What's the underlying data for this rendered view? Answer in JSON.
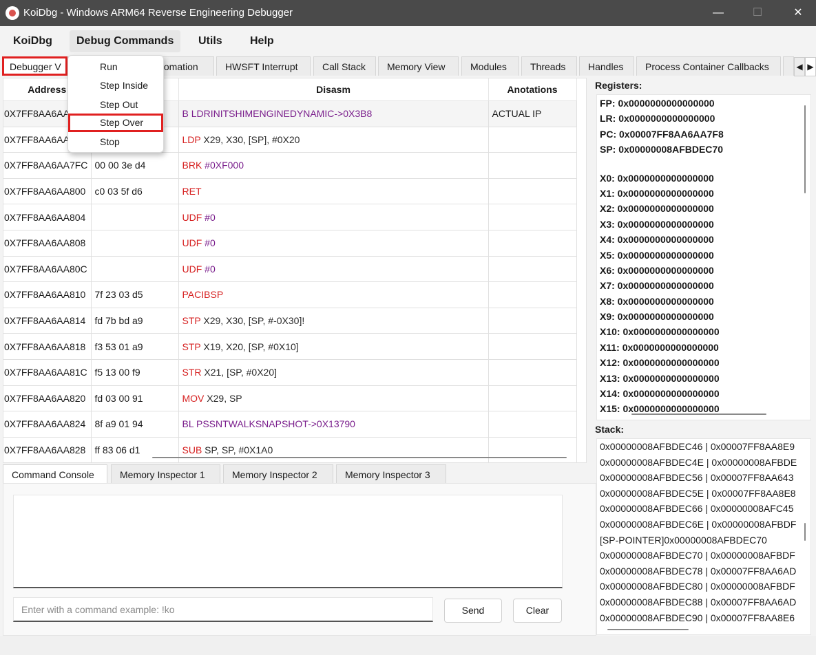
{
  "window": {
    "title": "KoiDbg - Windows ARM64 Reverse Engineering Debugger",
    "minimize": "—",
    "maximize": "☐",
    "close": "✕"
  },
  "menubar": [
    "KoiDbg",
    "Debug Commands",
    "Utils",
    "Help"
  ],
  "top_tabs": [
    "Debugger V",
    "tomation",
    "HWSFT Interrupt",
    "Call Stack",
    "Memory View",
    "Modules",
    "Threads",
    "Handles",
    "Process Container Callbacks"
  ],
  "tab_nav": {
    "left": "◀",
    "right": "▶"
  },
  "context_menu": [
    "Run",
    "Step Inside",
    "Step Out",
    "Step Over",
    "Stop"
  ],
  "disasm": {
    "columns": [
      "Address",
      "",
      "Disasm",
      "Anotations"
    ],
    "rows": [
      {
        "address": "0X7FF8AA6AA",
        "bytes": "",
        "mnemonic": "",
        "operands": "",
        "symbol": "B LDRINITSHIMENGINEDYNAMIC->0X3B8",
        "annotation": "ACTUAL IP"
      },
      {
        "address": "0X7FF8AA6AA",
        "bytes": "",
        "mnemonic": "LDP",
        "operands": " X29, X30, [SP], #0X20",
        "symbol": "",
        "annotation": ""
      },
      {
        "address": "0X7FF8AA6AA7FC",
        "bytes": "00 00 3e d4",
        "mnemonic": "BRK",
        "operands": "",
        "symbol": " #0XF000",
        "annotation": ""
      },
      {
        "address": "0X7FF8AA6AA800",
        "bytes": "c0 03 5f d6",
        "mnemonic": "RET",
        "operands": "",
        "symbol": "",
        "annotation": ""
      },
      {
        "address": "0X7FF8AA6AA804",
        "bytes": "",
        "mnemonic": "UDF",
        "operands": "",
        "symbol": " #0",
        "annotation": ""
      },
      {
        "address": "0X7FF8AA6AA808",
        "bytes": "",
        "mnemonic": "UDF",
        "operands": "",
        "symbol": " #0",
        "annotation": ""
      },
      {
        "address": "0X7FF8AA6AA80C",
        "bytes": "",
        "mnemonic": "UDF",
        "operands": "",
        "symbol": " #0",
        "annotation": ""
      },
      {
        "address": "0X7FF8AA6AA810",
        "bytes": "7f 23 03 d5",
        "mnemonic": "PACIBSP",
        "operands": "",
        "symbol": "",
        "annotation": ""
      },
      {
        "address": "0X7FF8AA6AA814",
        "bytes": "fd 7b bd a9",
        "mnemonic": "STP",
        "operands": " X29, X30, [SP, #-0X30]!",
        "symbol": "",
        "annotation": ""
      },
      {
        "address": "0X7FF8AA6AA818",
        "bytes": "f3 53 01 a9",
        "mnemonic": "STP",
        "operands": " X19, X20, [SP, #0X10]",
        "symbol": "",
        "annotation": ""
      },
      {
        "address": "0X7FF8AA6AA81C",
        "bytes": "f5 13 00 f9",
        "mnemonic": "STR",
        "operands": " X21, [SP, #0X20]",
        "symbol": "",
        "annotation": ""
      },
      {
        "address": "0X7FF8AA6AA820",
        "bytes": "fd 03 00 91",
        "mnemonic": "MOV",
        "operands": " X29, SP",
        "symbol": "",
        "annotation": ""
      },
      {
        "address": "0X7FF8AA6AA824",
        "bytes": "8f a9 01 94",
        "mnemonic": "",
        "operands": "",
        "symbol": "BL PSSNTWALKSNAPSHOT->0X13790",
        "annotation": ""
      },
      {
        "address": "0X7FF8AA6AA828",
        "bytes": "ff 83 06 d1",
        "mnemonic": "SUB",
        "operands": " SP, SP, #0X1A0",
        "symbol": "",
        "annotation": ""
      }
    ]
  },
  "bottom_tabs": [
    "Command Console",
    "Memory Inspector 1",
    "Memory Inspector 2",
    "Memory Inspector 3"
  ],
  "console": {
    "placeholder": "Enter with a command example: !ko",
    "send": "Send",
    "clear": "Clear"
  },
  "registers": {
    "label": "Registers:",
    "special": [
      "FP: 0x0000000000000000",
      "LR: 0x0000000000000000",
      "PC: 0x00007FF8AA6AA7F8",
      "SP: 0x00000008AFBDEC70"
    ],
    "general": [
      "X0: 0x0000000000000000",
      "X1: 0x0000000000000000",
      "X2: 0x0000000000000000",
      "X3: 0x0000000000000000",
      "X4: 0x0000000000000000",
      "X5: 0x0000000000000000",
      "X6: 0x0000000000000000",
      "X7: 0x0000000000000000",
      "X8: 0x0000000000000000",
      "X9: 0x0000000000000000",
      "X10: 0x0000000000000000",
      "X11: 0x0000000000000000",
      "X12: 0x0000000000000000",
      "X13: 0x0000000000000000",
      "X14: 0x0000000000000000",
      "X15: 0x0000000000000000"
    ]
  },
  "stack": {
    "label": "Stack:",
    "entries": [
      "0x00000008AFBDEC46 | 0x00007FF8AA8E9",
      "0x00000008AFBDEC4E | 0x00000008AFBDE",
      "0x00000008AFBDEC56 | 0x00007FF8AA643",
      "0x00000008AFBDEC5E | 0x00007FF8AA8E8",
      "0x00000008AFBDEC66 | 0x00000008AFC45",
      "0x00000008AFBDEC6E | 0x00000008AFBDF",
      "[SP-POINTER]0x00000008AFBDEC70",
      "0x00000008AFBDEC70 | 0x00000008AFBDF",
      "0x00000008AFBDEC78 | 0x00007FF8AA6AD",
      "0x00000008AFBDEC80 | 0x00000008AFBDF",
      "0x00000008AFBDEC88 | 0x00007FF8AA6AD",
      "0x00000008AFBDEC90 | 0x00007FF8AA8E6"
    ]
  },
  "colors": {
    "mnemonic": "#d62020",
    "symbol": "#7a1e8c",
    "highlight": "#e02020",
    "titlebar": "#4a4a4a"
  }
}
